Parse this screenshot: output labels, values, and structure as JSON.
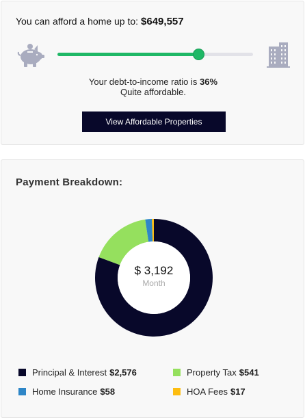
{
  "afford": {
    "prefix": "You can afford a home up to:",
    "amount": "$649,557",
    "slider_fraction": 0.72,
    "dti_prefix": "Your debt-to-income ratio is",
    "dti_value": "36%",
    "dti_note": "Quite affordable.",
    "button_label": "View Affordable Properties",
    "left_icon": "piggy-bank-icon",
    "right_icon": "building-icon"
  },
  "breakdown": {
    "title": "Payment Breakdown",
    "total": "$ 3,192",
    "period": "Month",
    "items": [
      {
        "label": "Principal & Interest",
        "value": "$2,576",
        "amount": 2576,
        "color": "#08082a"
      },
      {
        "label": "Property Tax",
        "value": "$541",
        "amount": 541,
        "color": "#95e05e"
      },
      {
        "label": "Home Insurance",
        "value": "$58",
        "amount": 58,
        "color": "#2e86c7"
      },
      {
        "label": "HOA Fees",
        "value": "$17",
        "amount": 17,
        "color": "#fdbd10"
      }
    ]
  },
  "colors": {
    "accent_green": "#1fb866",
    "navy": "#08082a",
    "icon_gray": "#a9acbf"
  }
}
